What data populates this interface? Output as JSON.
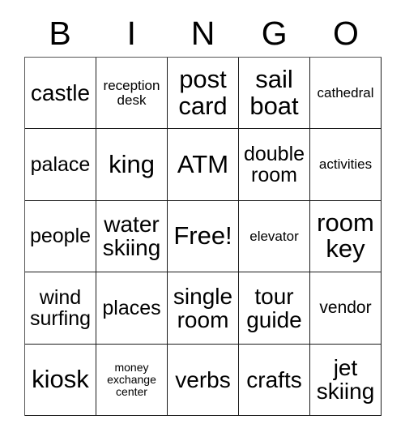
{
  "card": {
    "title": "BINGO",
    "headers": [
      "B",
      "I",
      "N",
      "G",
      "O"
    ],
    "free_space_label": "Free!",
    "rows": [
      [
        {
          "text": "castle",
          "size": "fs-lg"
        },
        {
          "text": "reception desk",
          "size": "fs-xs"
        },
        {
          "text": "post card",
          "size": "fs-xl"
        },
        {
          "text": "sail boat",
          "size": "fs-xl"
        },
        {
          "text": "cathedral",
          "size": "fs-xs"
        }
      ],
      [
        {
          "text": "palace",
          "size": "fs-md"
        },
        {
          "text": "king",
          "size": "fs-xl"
        },
        {
          "text": "ATM",
          "size": "fs-xl"
        },
        {
          "text": "double room",
          "size": "fs-md"
        },
        {
          "text": "activities",
          "size": "fs-xs"
        }
      ],
      [
        {
          "text": "people",
          "size": "fs-md"
        },
        {
          "text": "water skiing",
          "size": "fs-lg"
        },
        {
          "text": "Free!",
          "size": "fs-xl"
        },
        {
          "text": "elevator",
          "size": "fs-xs"
        },
        {
          "text": "room key",
          "size": "fs-xl"
        }
      ],
      [
        {
          "text": "wind surfing",
          "size": "fs-md"
        },
        {
          "text": "places",
          "size": "fs-md"
        },
        {
          "text": "single room",
          "size": "fs-lg"
        },
        {
          "text": "tour guide",
          "size": "fs-lg"
        },
        {
          "text": "vendor",
          "size": "fs-sm"
        }
      ],
      [
        {
          "text": "kiosk",
          "size": "fs-xl"
        },
        {
          "text": "money exchange center",
          "size": "fs-xxs"
        },
        {
          "text": "verbs",
          "size": "fs-lg"
        },
        {
          "text": "crafts",
          "size": "fs-lg"
        },
        {
          "text": "jet skiing",
          "size": "fs-lg"
        }
      ]
    ]
  },
  "colors": {
    "background": "#ffffff",
    "text": "#000000",
    "grid_line": "#1a1a1a"
  }
}
